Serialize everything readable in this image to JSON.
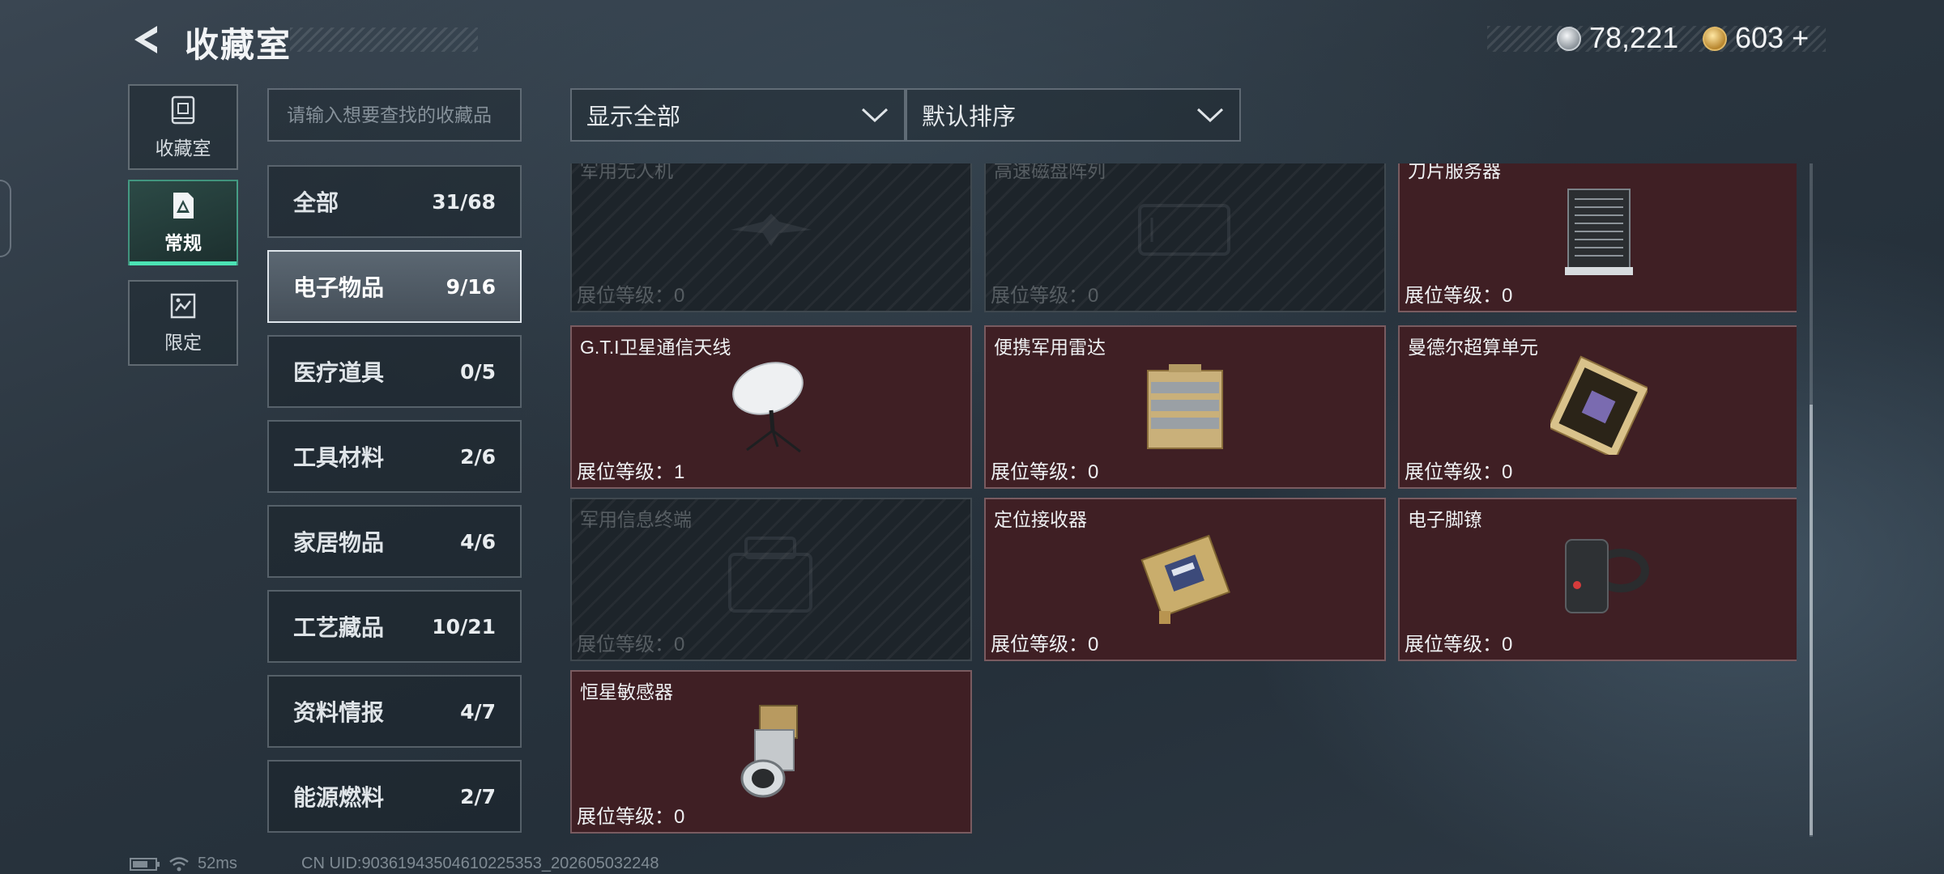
{
  "header": {
    "title": "收藏室"
  },
  "currency": {
    "silver": "78,221",
    "gold": "603",
    "plus": "+"
  },
  "side_tabs": [
    {
      "label": "收藏室",
      "icon": "collection-icon"
    },
    {
      "label": "常规",
      "icon": "regular-icon",
      "active": true
    },
    {
      "label": "限定",
      "icon": "limited-icon"
    }
  ],
  "search": {
    "placeholder": "请输入想要查找的收藏品"
  },
  "categories": [
    {
      "name": "全部",
      "count": "31/68"
    },
    {
      "name": "电子物品",
      "count": "9/16",
      "active": true
    },
    {
      "name": "医疗道具",
      "count": "0/5"
    },
    {
      "name": "工具材料",
      "count": "2/6"
    },
    {
      "name": "家居物品",
      "count": "4/6"
    },
    {
      "name": "工艺藏品",
      "count": "10/21"
    },
    {
      "name": "资料情报",
      "count": "4/7"
    },
    {
      "name": "能源燃料",
      "count": "2/7"
    }
  ],
  "filters": {
    "show": "显示全部",
    "sort": "默认排序"
  },
  "items": [
    {
      "name": "军用无人机",
      "level": "展位等级：0",
      "owned": false,
      "icon": "drone-icon"
    },
    {
      "name": "高速磁盘阵列",
      "level": "展位等级：0",
      "owned": false,
      "icon": "disk-array-icon"
    },
    {
      "name": "刀片服务器",
      "level": "展位等级：0",
      "owned": true,
      "icon": "blade-server-icon"
    },
    {
      "name": "G.T.I卫星通信天线",
      "level": "展位等级：1",
      "owned": true,
      "icon": "satellite-dish-icon"
    },
    {
      "name": "便携军用雷达",
      "level": "展位等级：0",
      "owned": true,
      "icon": "radar-icon"
    },
    {
      "name": "曼德尔超算单元",
      "level": "展位等级：0",
      "owned": true,
      "icon": "supercomputer-board-icon"
    },
    {
      "name": "军用信息终端",
      "level": "展位等级：0",
      "owned": false,
      "icon": "info-terminal-icon"
    },
    {
      "name": "定位接收器",
      "level": "展位等级：0",
      "owned": true,
      "icon": "locator-receiver-icon"
    },
    {
      "name": "电子脚镣",
      "level": "展位等级：0",
      "owned": true,
      "icon": "ankle-monitor-icon"
    },
    {
      "name": "恒星敏感器",
      "level": "展位等级：0",
      "owned": true,
      "icon": "star-sensor-icon"
    }
  ],
  "status": {
    "ping": "52ms",
    "uid": "CN UID:90361943504610225353_202605032248"
  }
}
